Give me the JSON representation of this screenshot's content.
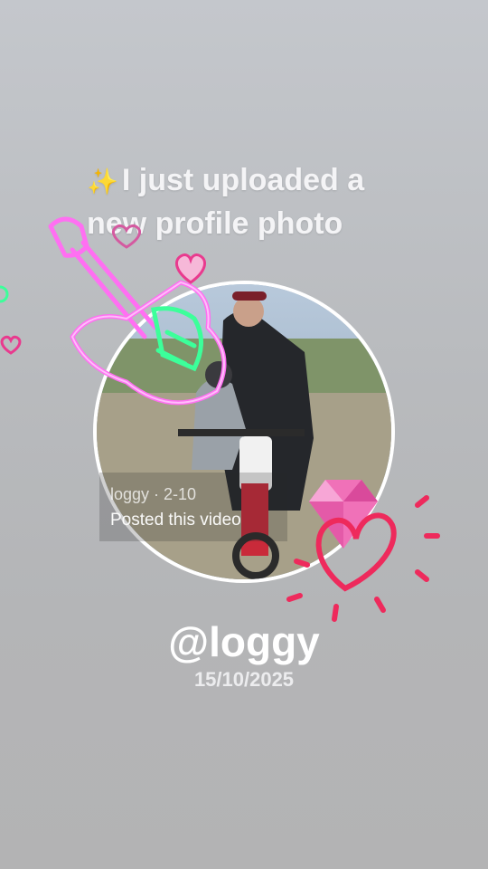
{
  "post": {
    "sparkle": "✨",
    "headline": "I just uploaded a new profile photo",
    "username": "@loggy",
    "date": "15/10/2025"
  },
  "video_tag": {
    "meta": "loggy · 2-10",
    "caption": "Posted this video"
  },
  "stickers": {
    "guitar": "neon-guitar-icon",
    "hearts": "heart-icon",
    "gem": "gem-icon",
    "doodle_heart": "doodle-heart-icon"
  },
  "colors": {
    "neon_pink": "#ff6ff2",
    "neon_green": "#3cff9a",
    "heart_red": "#ee2a5c",
    "ring_white": "#ffffff"
  }
}
